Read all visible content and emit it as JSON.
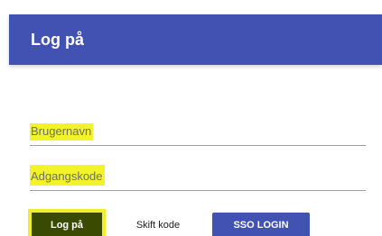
{
  "appbar": {
    "title": "Log på"
  },
  "form": {
    "username_label": "Brugernavn",
    "password_label": "Adgangskode"
  },
  "buttons": {
    "login": "Log på",
    "change_password": "Skift kode",
    "sso_login": "SSO LOGIN"
  },
  "colors": {
    "appbar": "#4152b3",
    "highlight": "#f3f32a",
    "login_button": "#3a4a00",
    "sso_button": "#4152b3"
  }
}
